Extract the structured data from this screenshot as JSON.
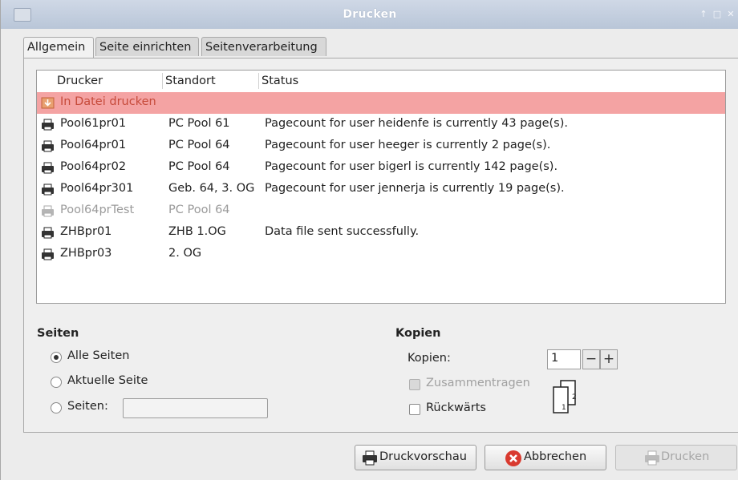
{
  "window": {
    "title": "Drucken",
    "controls": [
      "↑",
      "□",
      "✕"
    ]
  },
  "tabs": [
    {
      "label": "Allgemein",
      "active": true
    },
    {
      "label": "Seite einrichten",
      "active": false
    },
    {
      "label": "Seitenverarbeitung",
      "active": false
    }
  ],
  "printers": {
    "columns": [
      "Drucker",
      "Standort",
      "Status"
    ],
    "rows": [
      {
        "name": "In Datei drucken",
        "location": "",
        "status": "",
        "selected": true,
        "icon": "print-to-file-icon"
      },
      {
        "name": "Pool61pr01",
        "location": "PC Pool 61",
        "status": "Pagecount for user heidenfe is currently 43 page(s).",
        "icon": "printer-icon"
      },
      {
        "name": "Pool64pr01",
        "location": "PC Pool 64",
        "status": "Pagecount for user heeger is currently 2 page(s).",
        "icon": "printer-icon"
      },
      {
        "name": "Pool64pr02",
        "location": "PC Pool 64",
        "status": "Pagecount for user bigerl is currently 142 page(s).",
        "icon": "printer-icon"
      },
      {
        "name": "Pool64pr301",
        "location": "Geb. 64, 3. OG",
        "status": "Pagecount for user jennerja is currently 19 page(s).",
        "icon": "printer-icon"
      },
      {
        "name": "Pool64prTest",
        "location": "PC Pool 64",
        "status": "",
        "disabled": true,
        "icon": "printer-disabled-icon"
      },
      {
        "name": "ZHBpr01",
        "location": "ZHB 1.OG",
        "status": "Data file sent successfully.",
        "icon": "printer-icon"
      },
      {
        "name": "ZHBpr03",
        "location": "2. OG",
        "status": "",
        "icon": "printer-icon"
      }
    ]
  },
  "pages": {
    "heading": "Seiten",
    "all": "Alle Seiten",
    "current": "Aktuelle Seite",
    "range": "Seiten:",
    "range_value": ""
  },
  "copies": {
    "heading": "Kopien",
    "label": "Kopien:",
    "value": "1",
    "minus": "−",
    "plus": "+",
    "collate": "Zusammentragen",
    "reverse": "Rückwärts"
  },
  "buttons": {
    "preview": "Druckvorschau",
    "cancel": "Abbrechen",
    "print": "Drucken"
  },
  "colors": {
    "selection": "#f4a3a3",
    "titlebar": "#c4cfdf",
    "cancel_icon": "#d93a2f"
  }
}
